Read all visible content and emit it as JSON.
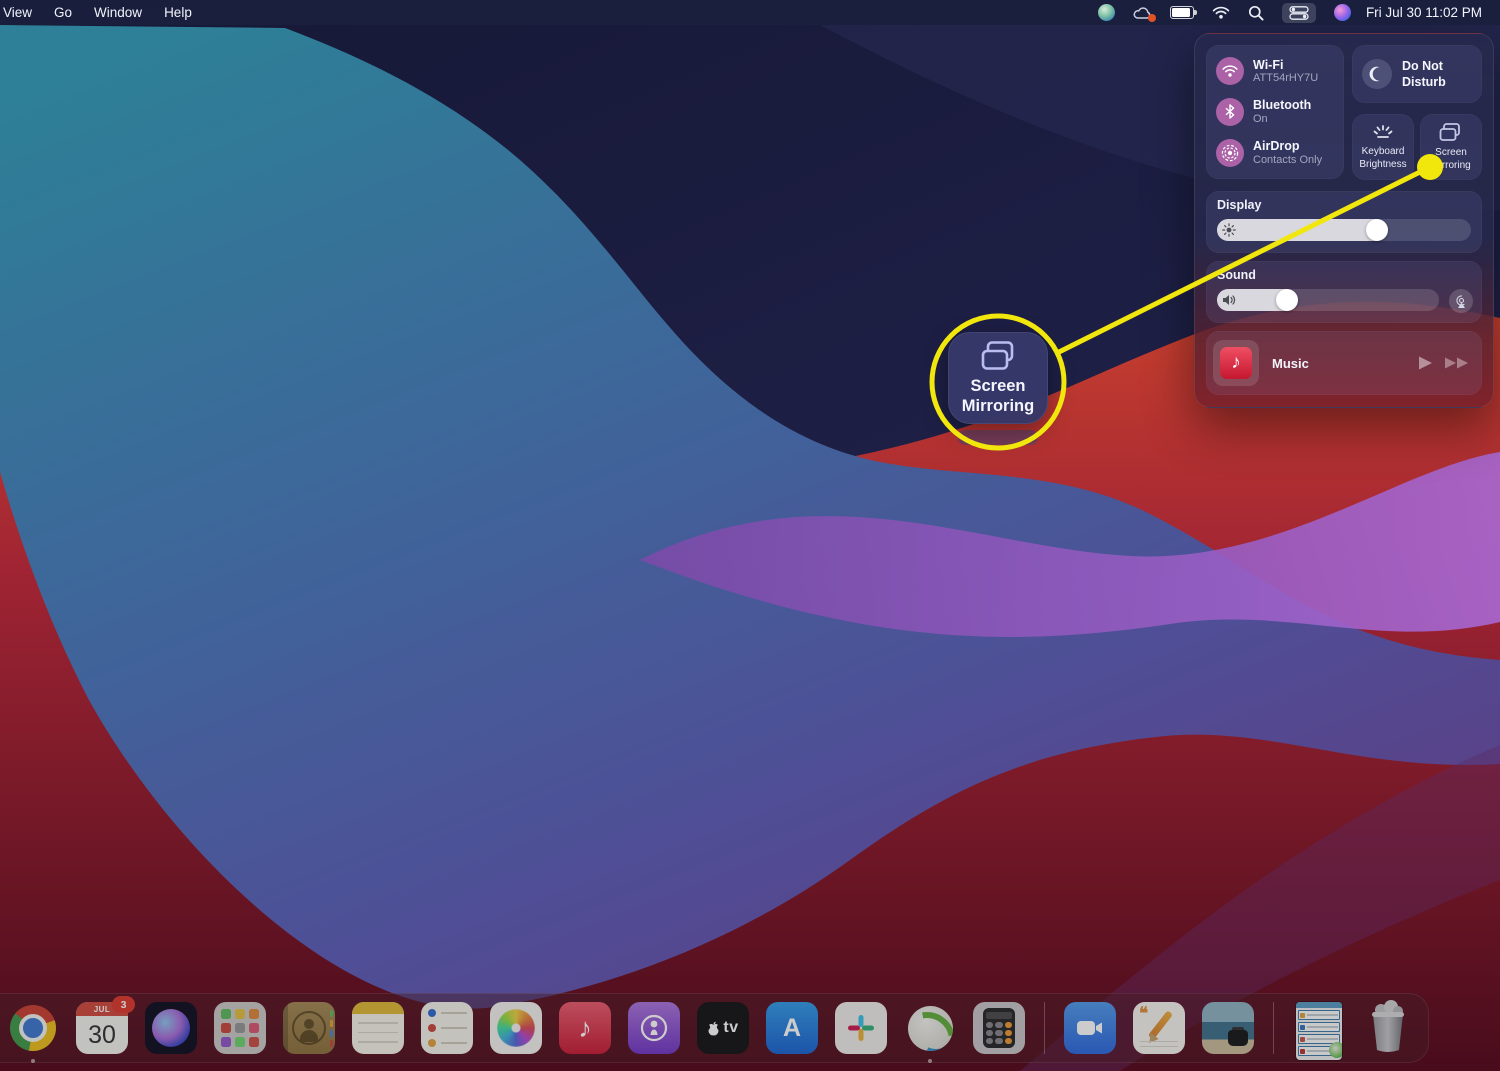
{
  "menu_bar": {
    "items": [
      {
        "label": "View"
      },
      {
        "label": "Go"
      },
      {
        "label": "Window"
      },
      {
        "label": "Help"
      }
    ],
    "status_icons": [
      "globe-icon",
      "cloud-app-icon",
      "battery-icon",
      "wifi-icon",
      "search-icon",
      "control-center-icon",
      "siri-icon"
    ],
    "clock": "Fri Jul 30 11:02 PM"
  },
  "control_center": {
    "wifi": {
      "title": "Wi-Fi",
      "subtitle": "ATT54rHY7U"
    },
    "bluetooth": {
      "title": "Bluetooth",
      "subtitle": "On"
    },
    "airdrop": {
      "title": "AirDrop",
      "subtitle": "Contacts Only"
    },
    "do_not_disturb": {
      "title": "Do Not Disturb"
    },
    "keyboard_brightness": {
      "title": "Keyboard Brightness"
    },
    "screen_mirroring": {
      "title": "Screen Mirroring"
    },
    "display": {
      "label": "Display",
      "value_pct": 67
    },
    "sound": {
      "label": "Sound",
      "value_pct": 36
    },
    "music": {
      "title": "Music"
    }
  },
  "callout": {
    "label": "Screen Mirroring",
    "accent_color": "#f2e70c"
  },
  "dock": {
    "calendar": {
      "month": "JUL",
      "day": "30",
      "badge": "3"
    },
    "apple_tv_label": "tv",
    "app_store_label": "A",
    "music_glyph": "♪",
    "apps": [
      {
        "name": "chrome",
        "running": true
      },
      {
        "name": "calendar",
        "running": false
      },
      {
        "name": "siri",
        "running": false
      },
      {
        "name": "launchpad",
        "running": false
      },
      {
        "name": "contacts",
        "running": false
      },
      {
        "name": "notes",
        "running": false
      },
      {
        "name": "reminders",
        "running": false
      },
      {
        "name": "photos",
        "running": false
      },
      {
        "name": "music",
        "running": false
      },
      {
        "name": "podcasts",
        "running": false
      },
      {
        "name": "apple-tv",
        "running": false
      },
      {
        "name": "app-store",
        "running": false
      },
      {
        "name": "slack",
        "running": false
      },
      {
        "name": "anyconnect-vpn",
        "running": true
      },
      {
        "name": "calculator",
        "running": false
      },
      {
        "name": "zoom",
        "running": false
      },
      {
        "name": "pages",
        "running": false
      },
      {
        "name": "ink-photo-app",
        "running": false
      },
      {
        "name": "minimized-window",
        "running": false
      },
      {
        "name": "trash",
        "running": false
      }
    ]
  }
}
